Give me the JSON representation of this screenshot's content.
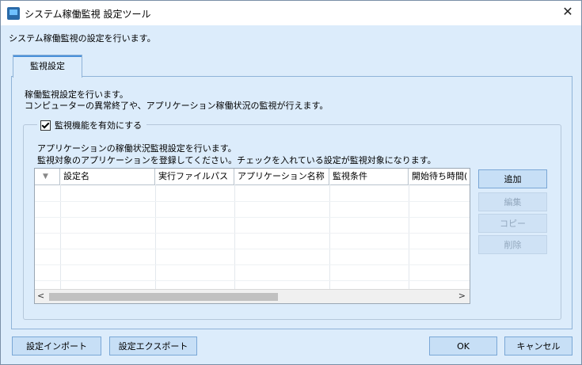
{
  "window": {
    "title": "システム稼働監視 設定ツール"
  },
  "description": "システム稼働監視の設定を行います。",
  "tab": {
    "label": "監視設定"
  },
  "intro": [
    "稼働監視設定を行います。",
    "コンピューターの異常終了や、アプリケーション稼働状況の監視が行えます。"
  ],
  "monitor": {
    "checkbox_label": "監視機能を有効にする",
    "checked": true,
    "guide": [
      "アプリケーションの稼働状況監視設定を行います。",
      "監視対象のアプリケーションを登録してください。チェックを入れている設定が監視対象になります。"
    ]
  },
  "grid": {
    "columns": [
      "設定名",
      "実行ファイルパス",
      "アプリケーション名称",
      "監視条件",
      "開始待ち時間("
    ],
    "rows": []
  },
  "side_buttons": {
    "add": "追加",
    "edit": "編集",
    "copy": "コピー",
    "delete": "削除"
  },
  "footer": {
    "import": "設定インポート",
    "export": "設定エクスポート",
    "ok": "OK",
    "cancel": "キャンセル"
  }
}
